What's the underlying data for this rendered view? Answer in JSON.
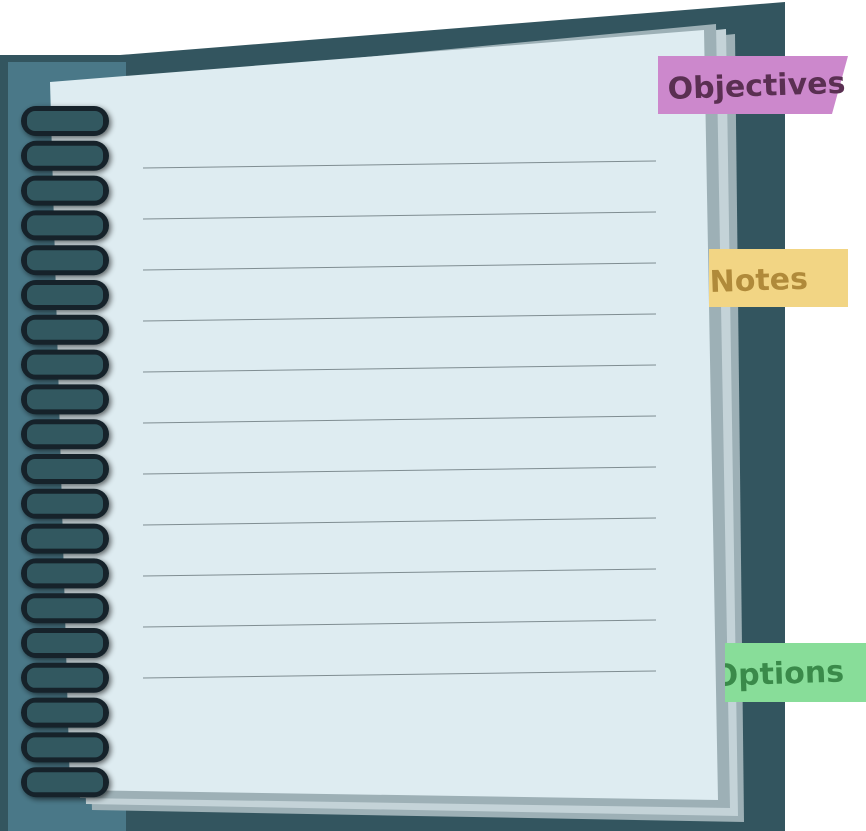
{
  "tabs": {
    "objectives": {
      "label": "Objectives",
      "color": "#cc88cc",
      "text_color": "#5a2f52"
    },
    "notes": {
      "label": "Notes",
      "color": "#f2d584",
      "text_color": "#b08a3a"
    },
    "options": {
      "label": "Options",
      "color": "#88dd99",
      "text_color": "#3a8a4a"
    }
  },
  "colors": {
    "cover": "#33555f",
    "spine": "#4a7888",
    "page": "#deecf1",
    "page_edge": "#9db0b6",
    "ring": "#335860",
    "rule_line": "#7f8d92"
  },
  "icons": {
    "binding": "spiral-binding-icon"
  }
}
